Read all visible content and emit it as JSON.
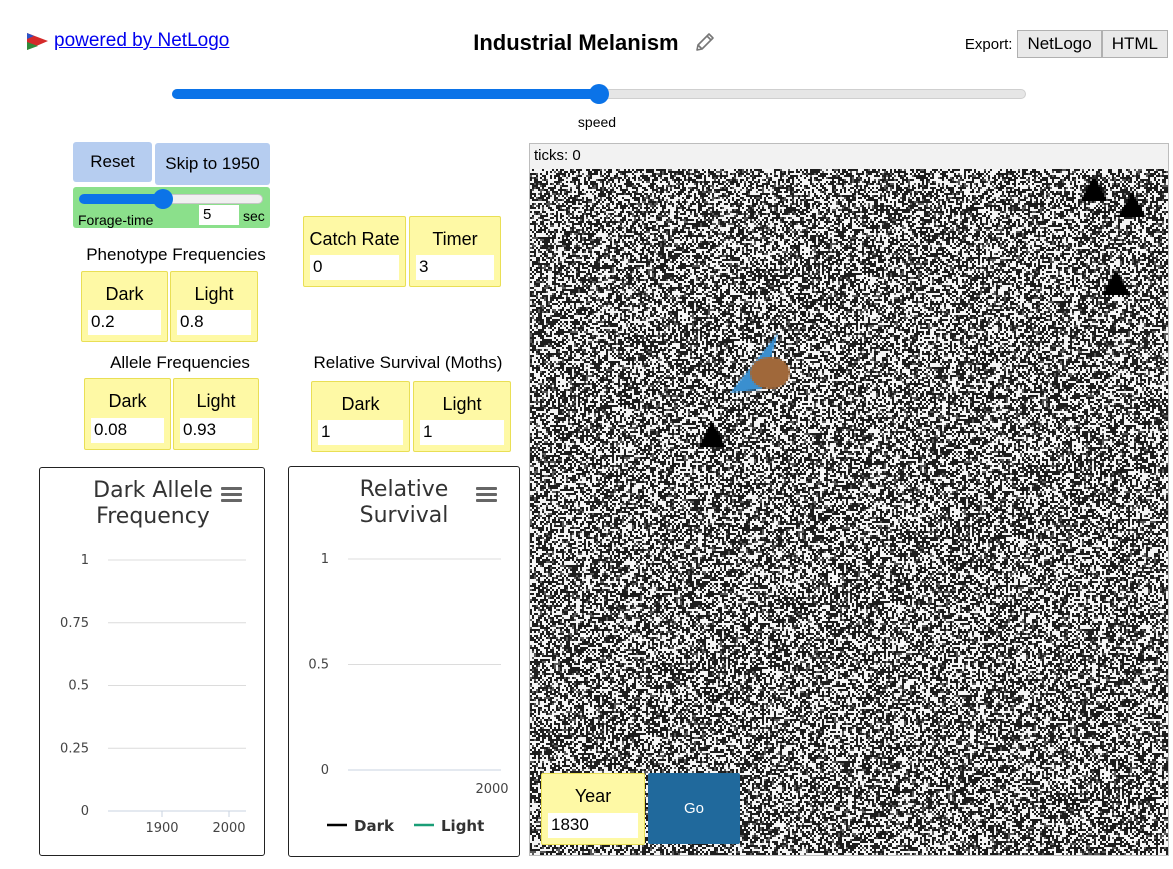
{
  "header": {
    "powered_by": "powered by NetLogo",
    "title": "Industrial Melanism",
    "export_label": "Export:",
    "export_netlogo": "NetLogo",
    "export_html": "HTML"
  },
  "speed": {
    "label": "speed",
    "value": 0.5
  },
  "controls": {
    "reset": "Reset",
    "skip": "Skip to 1950",
    "forage": {
      "label": "Forage-time",
      "value": "5",
      "unit": "sec",
      "fraction": 0.43
    },
    "go": "Go"
  },
  "phenotype": {
    "title": "Phenotype Frequencies",
    "dark_label": "Dark",
    "dark_value": "0.2",
    "light_label": "Light",
    "light_value": "0.8"
  },
  "allele": {
    "title": "Allele Frequencies",
    "dark_label": "Dark",
    "dark_value": "0.08",
    "light_label": "Light",
    "light_value": "0.93"
  },
  "catch": {
    "label": "Catch Rate",
    "value": "0"
  },
  "timer": {
    "label": "Timer",
    "value": "3"
  },
  "survival": {
    "title": "Relative Survival (Moths)",
    "dark_label": "Dark",
    "dark_value": "1",
    "light_label": "Light",
    "light_value": "1"
  },
  "world": {
    "ticks": "ticks: 0"
  },
  "year": {
    "label": "Year",
    "value": "1830"
  },
  "plot1": {
    "title": "Dark Allele\nFrequency",
    "y_ticks": [
      "1",
      "0.75",
      "0.5",
      "0.25",
      "0"
    ],
    "x_ticks": [
      "1900",
      "2000"
    ]
  },
  "plot2": {
    "title": "Relative\nSurvival",
    "y_ticks": [
      "1",
      "0.5",
      "0"
    ],
    "x_ticks": [
      "2000"
    ],
    "legend": [
      {
        "name": "Dark",
        "color": "#000000"
      },
      {
        "name": "Light",
        "color": "#1a9e77"
      }
    ]
  },
  "chart_data": [
    {
      "type": "line",
      "title": "Dark Allele\nFrequency",
      "xlabel": "",
      "ylabel": "",
      "ylim": [
        0,
        1
      ],
      "y_ticks": [
        0,
        0.25,
        0.5,
        0.75,
        1
      ],
      "x_ticks": [
        1900,
        2000
      ],
      "series": []
    },
    {
      "type": "line",
      "title": "Relative\nSurvival",
      "xlabel": "",
      "ylabel": "",
      "ylim": [
        0,
        1
      ],
      "y_ticks": [
        0,
        0.5,
        1
      ],
      "x_ticks": [
        2000
      ],
      "series": [
        {
          "name": "Dark",
          "color": "#000000",
          "values": []
        },
        {
          "name": "Light",
          "color": "#1a9e77",
          "values": []
        }
      ]
    }
  ]
}
